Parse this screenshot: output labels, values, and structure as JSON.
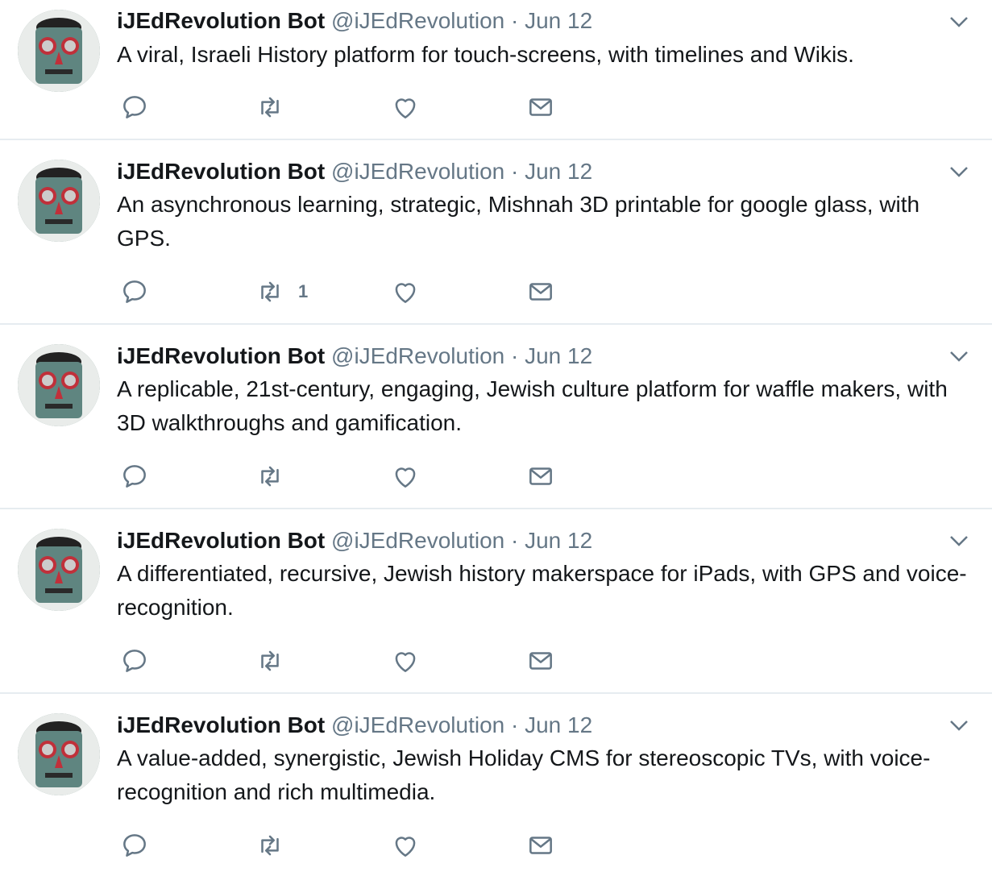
{
  "tweets": [
    {
      "name": "iJEdRevolution Bot",
      "handle": "@iJEdRevolution",
      "sep": "·",
      "date": "Jun 12",
      "text": "A viral, Israeli History platform for touch-screens, with timelines and Wikis.",
      "retweet_count": ""
    },
    {
      "name": "iJEdRevolution Bot",
      "handle": "@iJEdRevolution",
      "sep": "·",
      "date": "Jun 12",
      "text": "An asynchronous learning, strategic, Mishnah 3D printable for google glass, with GPS.",
      "retweet_count": "1"
    },
    {
      "name": "iJEdRevolution Bot",
      "handle": "@iJEdRevolution",
      "sep": "·",
      "date": "Jun 12",
      "text": "A replicable, 21st-century, engaging, Jewish culture platform for waffle makers, with 3D walkthroughs and gamification.",
      "retweet_count": ""
    },
    {
      "name": "iJEdRevolution Bot",
      "handle": "@iJEdRevolution",
      "sep": "·",
      "date": "Jun 12",
      "text": "A differentiated, recursive, Jewish history makerspace for iPads, with GPS and voice-recognition.",
      "retweet_count": ""
    },
    {
      "name": "iJEdRevolution Bot",
      "handle": "@iJEdRevolution",
      "sep": "·",
      "date": "Jun 12",
      "text": "A value-added, synergistic, Jewish Holiday CMS for stereoscopic TVs, with voice-recognition and rich multimedia.",
      "retweet_count": ""
    }
  ],
  "icons": {
    "reply": "reply-icon",
    "retweet": "retweet-icon",
    "like": "heart-icon",
    "dm": "envelope-icon",
    "menu": "chevron-down-icon",
    "avatar": "robot-avatar"
  },
  "colors": {
    "text": "#14171a",
    "muted": "#657786",
    "divider": "#e6ecf0"
  }
}
